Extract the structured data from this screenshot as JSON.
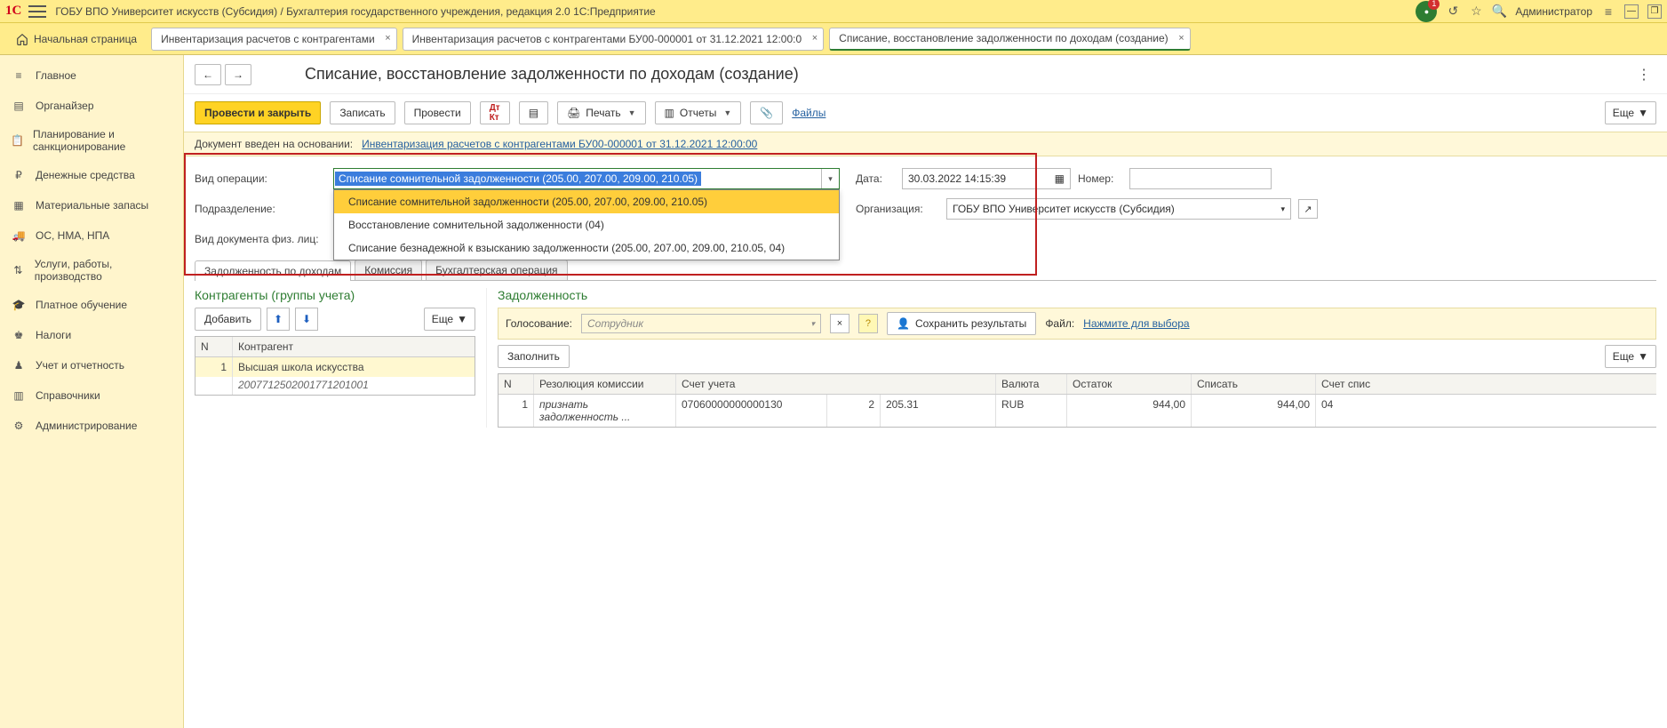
{
  "titlebar": {
    "title": "ГОБУ ВПО Университет искусств (Субсидия) / Бухгалтерия государственного учреждения, редакция 2.0 1С:Предприятие",
    "badge_count": "1",
    "user": "Администратор"
  },
  "tabs": {
    "home": "Начальная страница",
    "docs": [
      "Инвентаризация расчетов с контрагентами",
      "Инвентаризация расчетов с контрагентами БУ00-000001 от 31.12.2021 12:00:0",
      "Списание, восстановление задолженности по доходам (создание)"
    ]
  },
  "sidebar": [
    "Главное",
    "Органайзер",
    "Планирование и санкционирование",
    "Денежные средства",
    "Материальные запасы",
    "ОС, НМА, НПА",
    "Услуги, работы, производство",
    "Платное обучение",
    "Налоги",
    "Учет и отчетность",
    "Справочники",
    "Администрирование"
  ],
  "doc": {
    "title": "Списание, восстановление задолженности по доходам (создание)",
    "primary_btn": "Провести и закрыть",
    "btn_save": "Записать",
    "btn_post": "Провести",
    "btn_print": "Печать",
    "btn_reports": "Отчеты",
    "link_files": "Файлы",
    "btn_more": "Еще",
    "info_label": "Документ введен на основании:",
    "info_link": "Инвентаризация расчетов с контрагентами БУ00-000001 от 31.12.2021 12:00:00",
    "op_label": "Вид операции:",
    "op_value": "Списание сомнительной задолженности (205.00, 207.00, 209.00, 210.05)",
    "op_options": [
      "Списание сомнительной задолженности (205.00, 207.00, 209.00, 210.05)",
      "Восстановление сомнительной задолженности (04)",
      "Списание безнадежной к взысканию задолженности (205.00, 207.00, 209.00, 210.05, 04)"
    ],
    "date_label": "Дата:",
    "date_value": "30.03.2022 14:15:39",
    "number_label": "Номер:",
    "dept_label": "Подразделение:",
    "org_label": "Организация:",
    "org_value": "ГОБУ ВПО Университет искусств (Субсидия)",
    "indiv_label": "Вид документа физ. лиц:",
    "tabs": [
      "Задолженность по доходам",
      "Комиссия",
      "Бухгалтерская операция"
    ]
  },
  "left_panel": {
    "title": "Контрагенты (группы учета)",
    "btn_add": "Добавить",
    "btn_more": "Еще",
    "cols": [
      "N",
      "Контрагент"
    ],
    "row_num": "1",
    "row_name": "Высшая школа искусства",
    "row_code": "2007712502001771201001"
  },
  "right_panel": {
    "title": "Задолженность",
    "vote_label": "Голосование:",
    "vote_placeholder": "Сотрудник",
    "btn_save_vote": "Сохранить результаты",
    "file_label": "Файл:",
    "file_link": "Нажмите для выбора",
    "btn_fill": "Заполнить",
    "btn_more": "Еще",
    "cols": [
      "N",
      "Резолюция комиссии",
      "Счет учета",
      "",
      "",
      "Валюта",
      "Остаток",
      "Списать",
      "Счет спис"
    ],
    "row": {
      "n": "1",
      "res": "признать задолженность ...",
      "acct": "07060000000000130",
      "c2": "2",
      "c3": "205.31",
      "cur": "RUB",
      "rem": "944,00",
      "wr": "944,00",
      "wracct": "04"
    }
  }
}
